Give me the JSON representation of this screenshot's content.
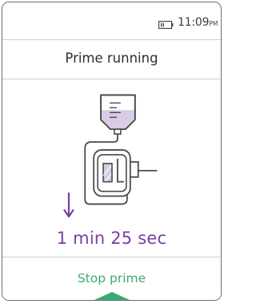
{
  "status": {
    "time": "11:09",
    "ampm": "PM",
    "battery_icon": "battery-icon"
  },
  "screen": {
    "title": "Prime running"
  },
  "illustration": {
    "icons": [
      "iv-bag-icon",
      "tubing-icon",
      "pump-cartridge-icon"
    ],
    "flow_arrow_icon": "down-arrow-icon"
  },
  "timer": {
    "remaining": "1 min 25 sec"
  },
  "actions": {
    "stop_label": "Stop prime"
  },
  "colors": {
    "accent_purple": "#7b3fa3",
    "action_green": "#3aaa73",
    "line_gray": "#4a4a4a",
    "fluid_lavender": "#d8cce6",
    "border": "#6f6f73"
  }
}
